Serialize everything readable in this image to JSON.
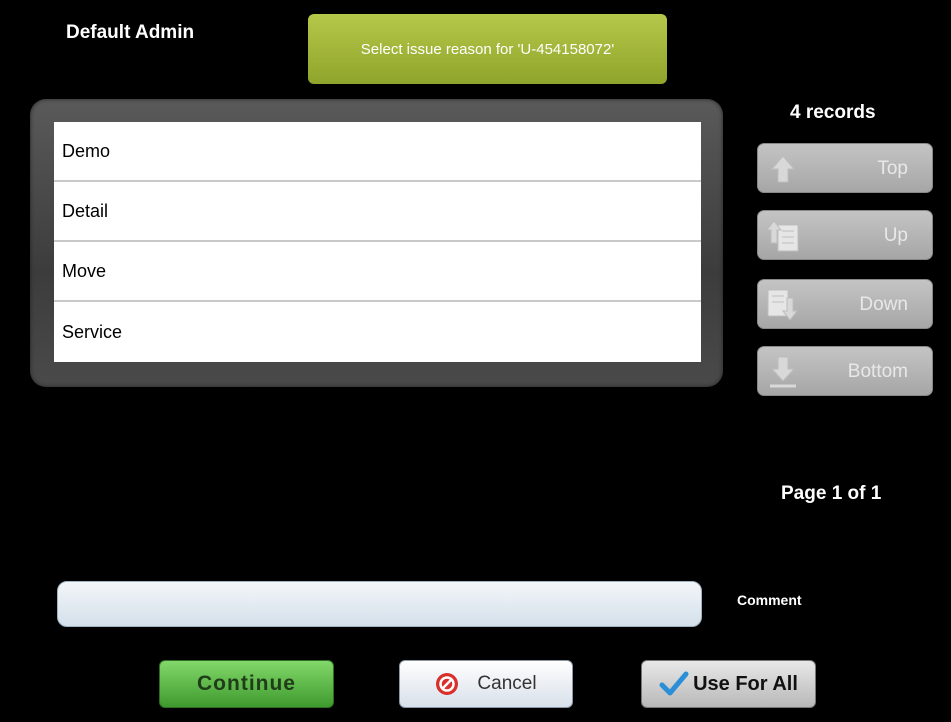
{
  "header": {
    "user_name": "Default Admin",
    "banner_text": "Select issue reason for 'U-454158072'"
  },
  "list": {
    "items": [
      {
        "label": "Demo"
      },
      {
        "label": "Detail"
      },
      {
        "label": "Move"
      },
      {
        "label": "Service"
      }
    ]
  },
  "pager": {
    "records_text": "4 records",
    "top_label": "Top",
    "up_label": "Up",
    "down_label": "Down",
    "bottom_label": "Bottom",
    "page_text": "Page 1 of 1"
  },
  "comment": {
    "label": "Comment",
    "value": ""
  },
  "actions": {
    "continue_label": "Continue",
    "cancel_label": "Cancel",
    "use_for_all_label": "Use For All"
  },
  "colors": {
    "banner": "#9eb438",
    "continue": "#5cb845",
    "nav_disabled": "#b4b4b4",
    "cancel_icon": "#d9302b",
    "check_icon": "#2a8fd6"
  }
}
